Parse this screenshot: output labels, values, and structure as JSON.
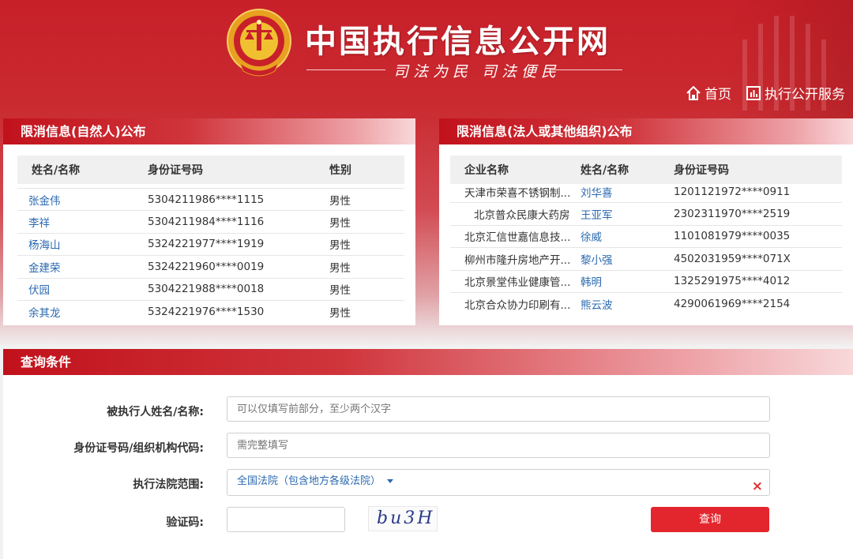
{
  "header": {
    "site_title": "中国执行信息公开网",
    "slogan": "司法为民   司法便民",
    "nav": [
      {
        "label": "首页",
        "icon": "home-icon"
      },
      {
        "label": "执行公开服务",
        "icon": "service-chart-icon"
      }
    ]
  },
  "natural_panel": {
    "title": "限消信息(自然人)公布",
    "columns": [
      "姓名/名称",
      "身份证号码",
      "性别"
    ],
    "rows": [
      {
        "name": "张金伟",
        "id": "5304211986****1115",
        "gender": "男性"
      },
      {
        "name": "李祥",
        "id": "5304211984****1116",
        "gender": "男性"
      },
      {
        "name": "杨海山",
        "id": "5324221977****1919",
        "gender": "男性"
      },
      {
        "name": "金建荣",
        "id": "5324221960****0019",
        "gender": "男性"
      },
      {
        "name": "伏园",
        "id": "5304221988****0018",
        "gender": "男性"
      },
      {
        "name": "余其龙",
        "id": "5324221976****1530",
        "gender": "男性"
      }
    ]
  },
  "legal_panel": {
    "title": "限消信息(法人或其他组织)公布",
    "columns": [
      "企业名称",
      "姓名/名称",
      "身份证号码"
    ],
    "rows": [
      {
        "company": "天津市荣喜不锈钢制...",
        "name": "刘华喜",
        "id": "1201121972****0911"
      },
      {
        "company": "北京普众民康大药房",
        "name": "王亚军",
        "id": "2302311970****2519"
      },
      {
        "company": "北京汇信世嘉信息技...",
        "name": "徐威",
        "id": "1101081979****0035"
      },
      {
        "company": "柳州市隆升房地产开...",
        "name": "黎小强",
        "id": "4502031959****071X"
      },
      {
        "company": "北京景堂伟业健康管...",
        "name": "韩明",
        "id": "1325291975****4012"
      },
      {
        "company": "北京合众协力印刷有...",
        "name": "熊云波",
        "id": "4290061969****2154"
      }
    ]
  },
  "query": {
    "title": "查询条件",
    "name_label": "被执行人姓名/名称:",
    "name_placeholder": "可以仅填写前部分，至少两个汉字",
    "id_label": "身份证号码/组织机构代码:",
    "id_placeholder": "需完整填写",
    "court_label": "执行法院范围:",
    "court_value": "全国法院（包含地方各级法院）",
    "clear_symbol": "×",
    "captcha_label": "验证码:",
    "captcha_text": "bu3H",
    "submit_label": "查询"
  },
  "colors": {
    "brand_red": "#c8202a",
    "link_blue": "#2b6ab0",
    "button_red": "#e3262e"
  }
}
